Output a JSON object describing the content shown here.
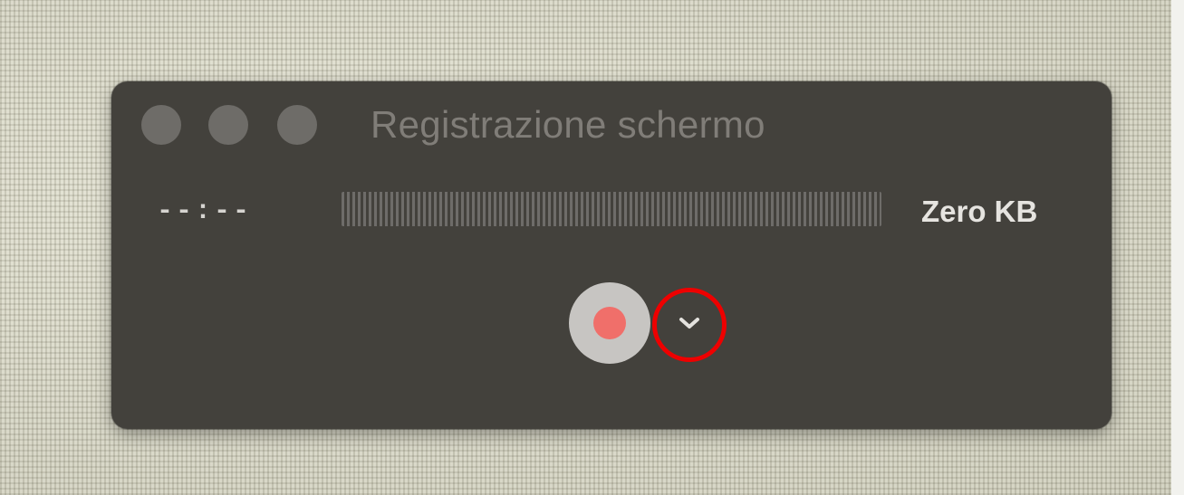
{
  "window": {
    "title": "Registrazione schermo",
    "traffic_lights": [
      "close-icon",
      "minimize-icon",
      "zoom-icon"
    ]
  },
  "recorder": {
    "time": "--:--",
    "file_size": "Zero KB",
    "record_button_icon": "record-icon",
    "options_icon": "chevron-down-icon",
    "highlight_color": "#ee0000"
  },
  "colors": {
    "window_bg": "#43413c",
    "record_dot": "#f06f6a",
    "record_button": "#c7c5c2"
  }
}
